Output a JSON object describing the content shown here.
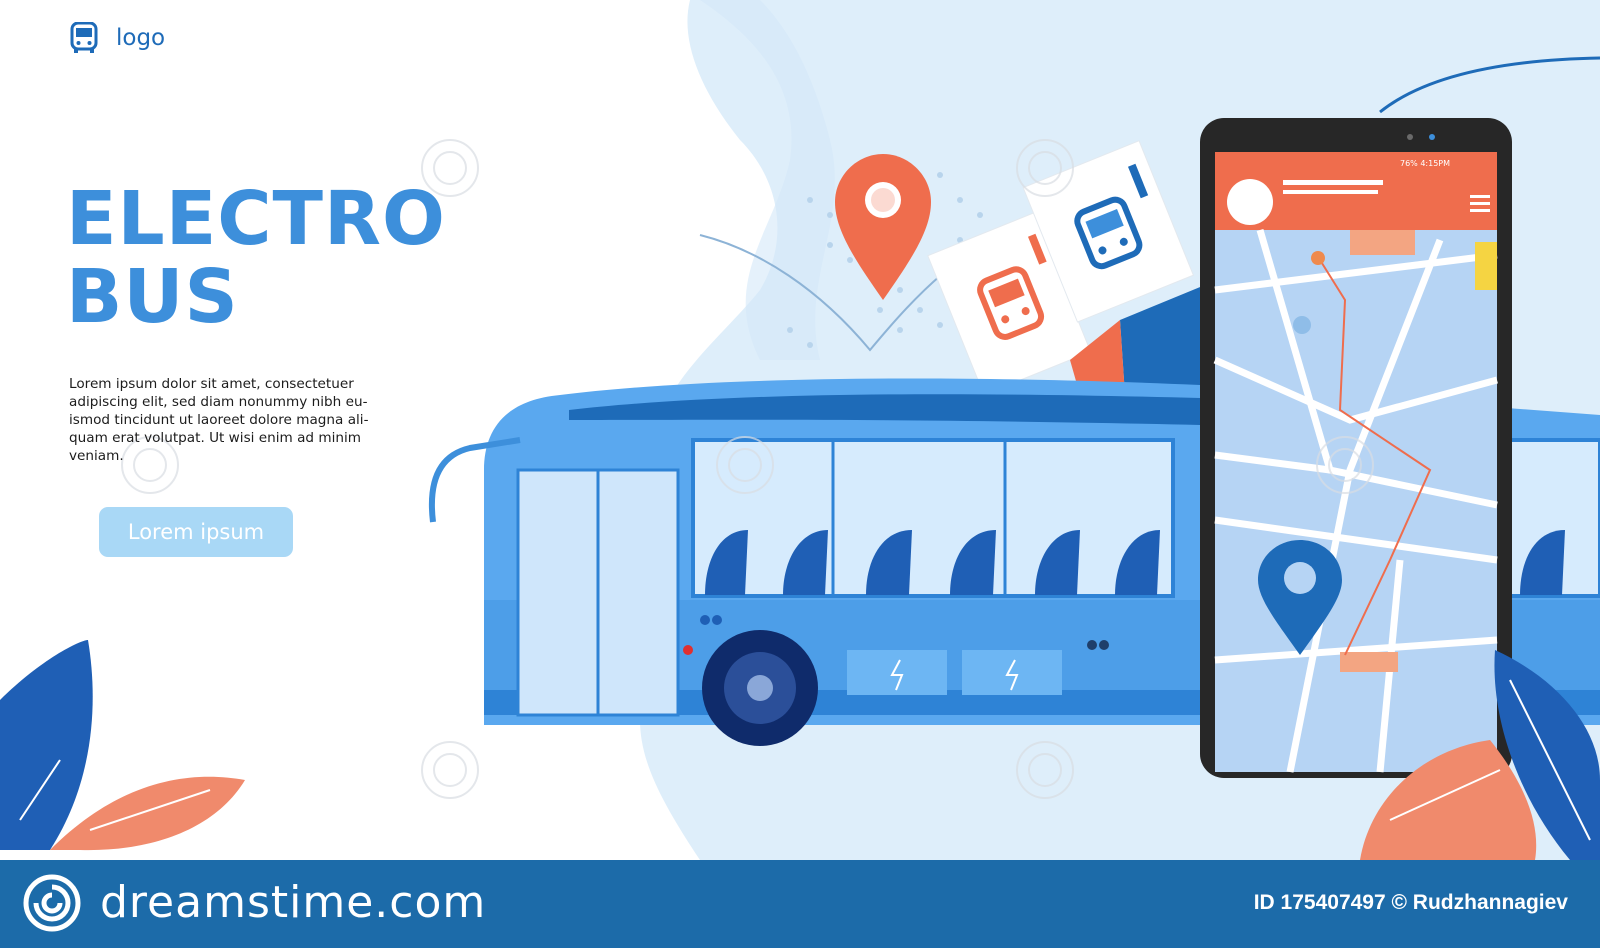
{
  "header": {
    "logo_label": "logo",
    "logo_icon": "bus-icon"
  },
  "hero": {
    "title_line1": "ELECTRO",
    "title_line2": "BUS",
    "description": "Lorem ipsum dolor sit amet, consectetuer\nadipiscing elit, sed diam nonummy nibh eu-\nismod tincidunt ut laoreet dolore magna ali-\nquam erat volutpat. Ut wisi enim ad minim\nveniam.",
    "cta_label": "Lorem ipsum"
  },
  "phone": {
    "status_text": "76% 4:15PM",
    "menu_icon": "hamburger-menu-icon"
  },
  "footer": {
    "brand_text": "dreamstime.com",
    "brand_icon": "dreamstime-swirl-icon",
    "credit": "ID 175407497 © Rudzhannagiev"
  },
  "colors": {
    "accent_blue": "#3d8fdb",
    "button_light_blue": "#a9d8f6",
    "footer_blue": "#1c6ba9",
    "pin_orange": "#ef6d4d",
    "leaf_dark_blue": "#1f5fb5",
    "leaf_salmon": "#f08a6c"
  }
}
